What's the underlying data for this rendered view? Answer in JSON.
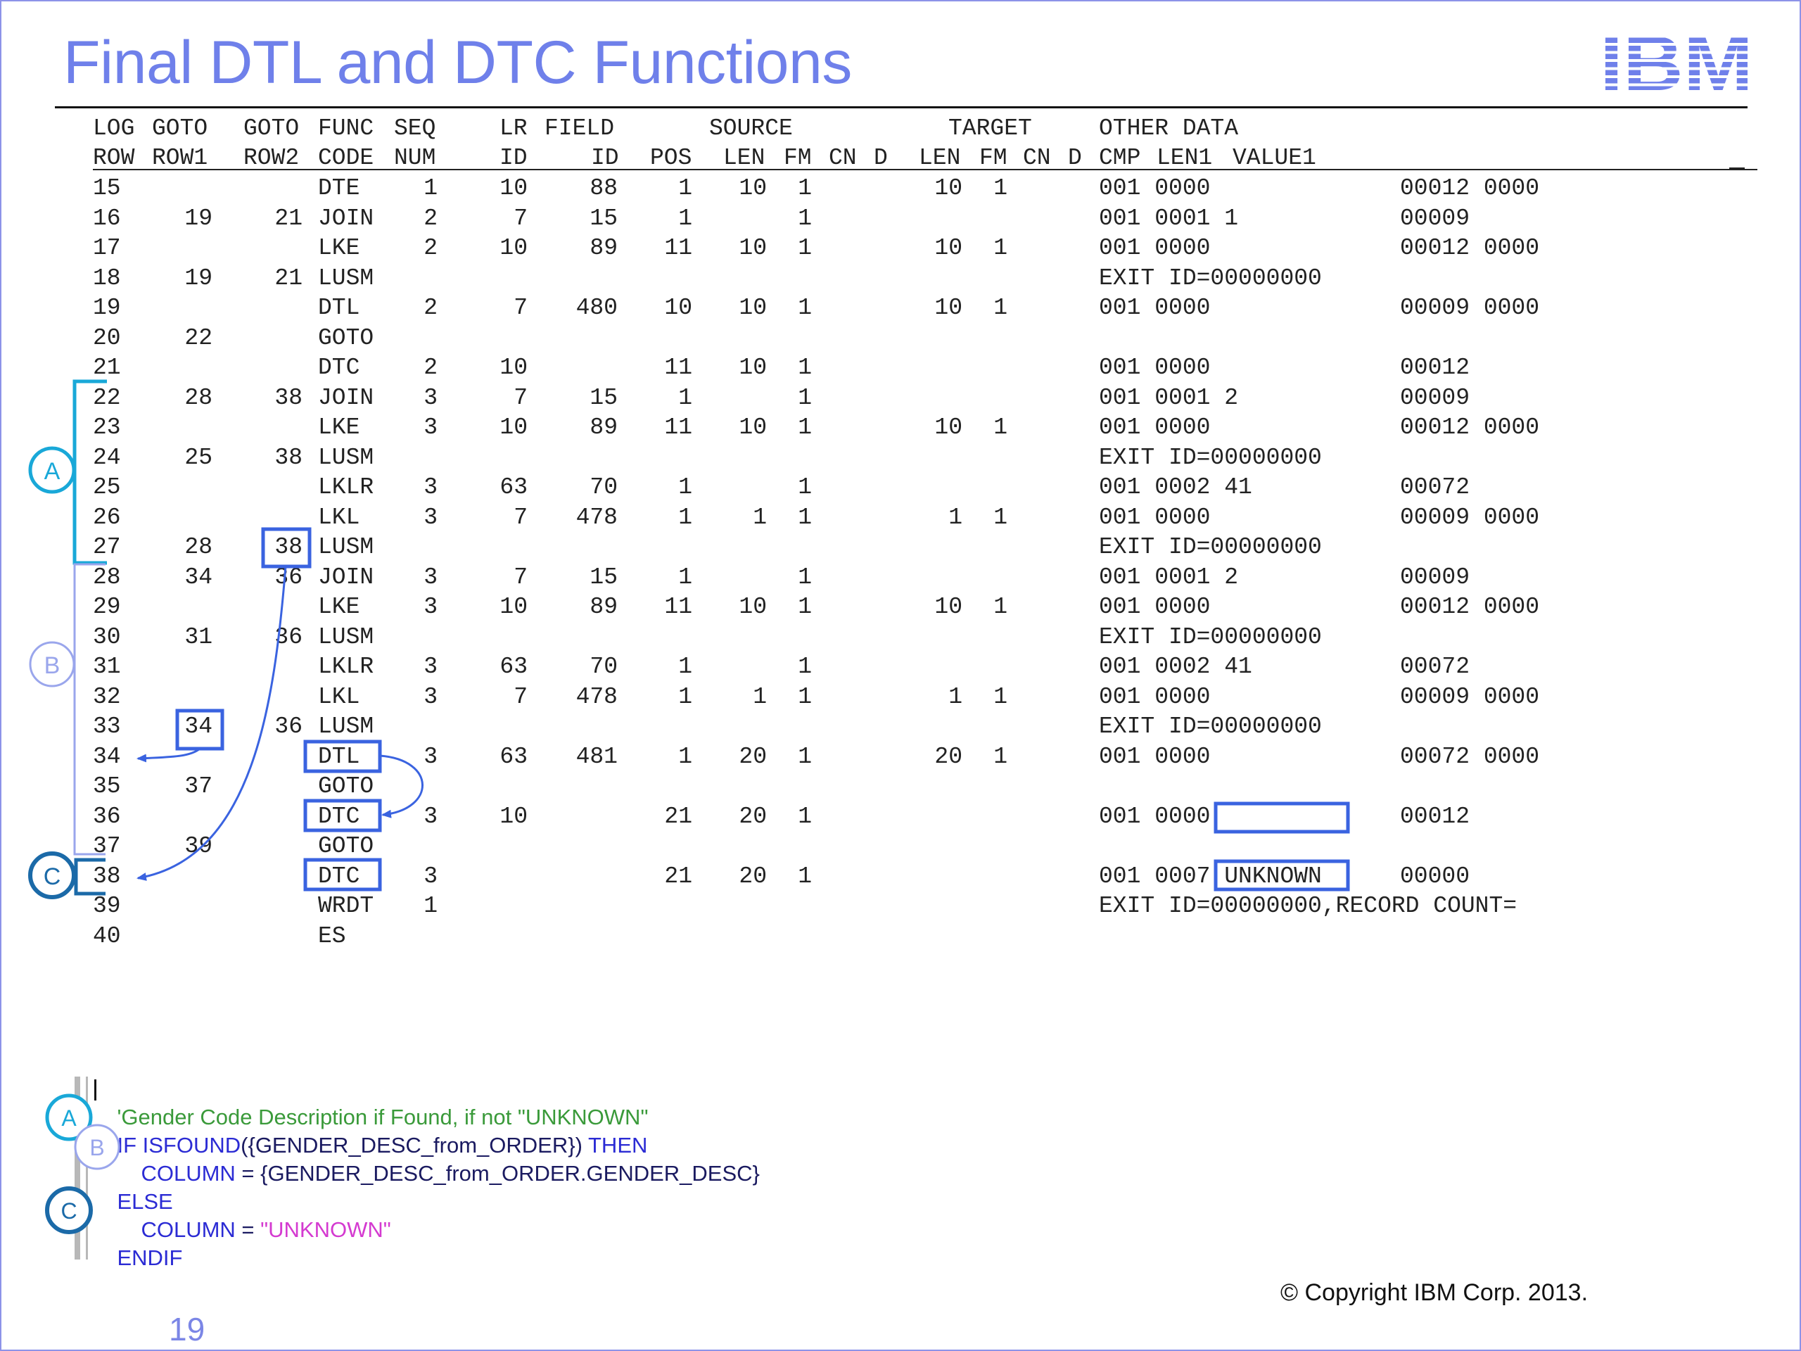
{
  "slide": {
    "title": "Final DTL and DTC Functions",
    "logo_text": "IBM",
    "copyright": "© Copyright IBM Corp. 2013.",
    "page_number": "19"
  },
  "headers": {
    "line1": [
      "LOG",
      "GOTO",
      "GOTO",
      "FUNC",
      "SEQ",
      "LR",
      "FIELD",
      "SOURCE",
      "TARGET",
      "OTHER DATA"
    ],
    "line2": [
      "ROW",
      "ROW1",
      "ROW2",
      "CODE",
      "NUM",
      "ID",
      "ID",
      "POS",
      "LEN",
      "FM",
      "CN",
      "D",
      "LEN",
      "FM",
      "CN",
      "D",
      "CMP",
      "LEN1",
      "VALUE1"
    ]
  },
  "rows": [
    {
      "row": "15",
      "goto1": "",
      "goto2": "",
      "func": "DTE",
      "seq": "1",
      "lr": "10",
      "field": "88",
      "pos": "1",
      "slen": "10",
      "sfm": "1",
      "tlen": "10",
      "tfm": "1",
      "cmp": "001 0000",
      "tail": "00012 0000"
    },
    {
      "row": "16",
      "goto1": "19",
      "goto2": "21",
      "func": "JOIN",
      "seq": "2",
      "lr": "7",
      "field": "15",
      "pos": "1",
      "slen": "",
      "sfm": "1",
      "tlen": "",
      "tfm": "",
      "cmp": "001 0001 1",
      "tail": "00009"
    },
    {
      "row": "17",
      "goto1": "",
      "goto2": "",
      "func": "LKE",
      "seq": "2",
      "lr": "10",
      "field": "89",
      "pos": "11",
      "slen": "10",
      "sfm": "1",
      "tlen": "10",
      "tfm": "1",
      "cmp": "001 0000",
      "tail": "00012 0000"
    },
    {
      "row": "18",
      "goto1": "19",
      "goto2": "21",
      "func": "LUSM",
      "seq": "",
      "lr": "",
      "field": "",
      "pos": "",
      "slen": "",
      "sfm": "",
      "tlen": "",
      "tfm": "",
      "cmp": "EXIT ID=00000000",
      "tail": ""
    },
    {
      "row": "19",
      "goto1": "",
      "goto2": "",
      "func": "DTL",
      "seq": "2",
      "lr": "7",
      "field": "480",
      "pos": "10",
      "slen": "10",
      "sfm": "1",
      "tlen": "10",
      "tfm": "1",
      "cmp": "001 0000",
      "tail": "00009 0000"
    },
    {
      "row": "20",
      "goto1": "22",
      "goto2": "",
      "func": "GOTO",
      "seq": "",
      "lr": "",
      "field": "",
      "pos": "",
      "slen": "",
      "sfm": "",
      "tlen": "",
      "tfm": "",
      "cmp": "",
      "tail": ""
    },
    {
      "row": "21",
      "goto1": "",
      "goto2": "",
      "func": "DTC",
      "seq": "2",
      "lr": "10",
      "field": "",
      "pos": "11",
      "slen": "10",
      "sfm": "1",
      "tlen": "",
      "tfm": "",
      "cmp": "001 0000",
      "tail": "00012"
    },
    {
      "row": "22",
      "goto1": "28",
      "goto2": "38",
      "func": "JOIN",
      "seq": "3",
      "lr": "7",
      "field": "15",
      "pos": "1",
      "slen": "",
      "sfm": "1",
      "tlen": "",
      "tfm": "",
      "cmp": "001 0001 2",
      "tail": "00009"
    },
    {
      "row": "23",
      "goto1": "",
      "goto2": "",
      "func": "LKE",
      "seq": "3",
      "lr": "10",
      "field": "89",
      "pos": "11",
      "slen": "10",
      "sfm": "1",
      "tlen": "10",
      "tfm": "1",
      "cmp": "001 0000",
      "tail": "00012 0000"
    },
    {
      "row": "24",
      "goto1": "25",
      "goto2": "38",
      "func": "LUSM",
      "seq": "",
      "lr": "",
      "field": "",
      "pos": "",
      "slen": "",
      "sfm": "",
      "tlen": "",
      "tfm": "",
      "cmp": "EXIT ID=00000000",
      "tail": ""
    },
    {
      "row": "25",
      "goto1": "",
      "goto2": "",
      "func": "LKLR",
      "seq": "3",
      "lr": "63",
      "field": "70",
      "pos": "1",
      "slen": "",
      "sfm": "1",
      "tlen": "",
      "tfm": "",
      "cmp": "001 0002 41",
      "tail": "00072"
    },
    {
      "row": "26",
      "goto1": "",
      "goto2": "",
      "func": "LKL",
      "seq": "3",
      "lr": "7",
      "field": "478",
      "pos": "1",
      "slen": "1",
      "sfm": "1",
      "tlen": "1",
      "tfm": "1",
      "cmp": "001 0000",
      "tail": "00009 0000"
    },
    {
      "row": "27",
      "goto1": "28",
      "goto2": "38",
      "func": "LUSM",
      "seq": "",
      "lr": "",
      "field": "",
      "pos": "",
      "slen": "",
      "sfm": "",
      "tlen": "",
      "tfm": "",
      "cmp": "EXIT ID=00000000",
      "tail": ""
    },
    {
      "row": "28",
      "goto1": "34",
      "goto2": "36",
      "func": "JOIN",
      "seq": "3",
      "lr": "7",
      "field": "15",
      "pos": "1",
      "slen": "",
      "sfm": "1",
      "tlen": "",
      "tfm": "",
      "cmp": "001 0001 2",
      "tail": "00009"
    },
    {
      "row": "29",
      "goto1": "",
      "goto2": "",
      "func": "LKE",
      "seq": "3",
      "lr": "10",
      "field": "89",
      "pos": "11",
      "slen": "10",
      "sfm": "1",
      "tlen": "10",
      "tfm": "1",
      "cmp": "001 0000",
      "tail": "00012 0000"
    },
    {
      "row": "30",
      "goto1": "31",
      "goto2": "36",
      "func": "LUSM",
      "seq": "",
      "lr": "",
      "field": "",
      "pos": "",
      "slen": "",
      "sfm": "",
      "tlen": "",
      "tfm": "",
      "cmp": "EXIT ID=00000000",
      "tail": ""
    },
    {
      "row": "31",
      "goto1": "",
      "goto2": "",
      "func": "LKLR",
      "seq": "3",
      "lr": "63",
      "field": "70",
      "pos": "1",
      "slen": "",
      "sfm": "1",
      "tlen": "",
      "tfm": "",
      "cmp": "001 0002 41",
      "tail": "00072"
    },
    {
      "row": "32",
      "goto1": "",
      "goto2": "",
      "func": "LKL",
      "seq": "3",
      "lr": "7",
      "field": "478",
      "pos": "1",
      "slen": "1",
      "sfm": "1",
      "tlen": "1",
      "tfm": "1",
      "cmp": "001 0000",
      "tail": "00009 0000"
    },
    {
      "row": "33",
      "goto1": "34",
      "goto2": "36",
      "func": "LUSM",
      "seq": "",
      "lr": "",
      "field": "",
      "pos": "",
      "slen": "",
      "sfm": "",
      "tlen": "",
      "tfm": "",
      "cmp": "EXIT ID=00000000",
      "tail": ""
    },
    {
      "row": "34",
      "goto1": "",
      "goto2": "",
      "func": "DTL",
      "seq": "3",
      "lr": "63",
      "field": "481",
      "pos": "1",
      "slen": "20",
      "sfm": "1",
      "tlen": "20",
      "tfm": "1",
      "cmp": "001 0000",
      "tail": "00072 0000"
    },
    {
      "row": "35",
      "goto1": "37",
      "goto2": "",
      "func": "GOTO",
      "seq": "",
      "lr": "",
      "field": "",
      "pos": "",
      "slen": "",
      "sfm": "",
      "tlen": "",
      "tfm": "",
      "cmp": "",
      "tail": ""
    },
    {
      "row": "36",
      "goto1": "",
      "goto2": "",
      "func": "DTC",
      "seq": "3",
      "lr": "10",
      "field": "",
      "pos": "21",
      "slen": "20",
      "sfm": "1",
      "tlen": "",
      "tfm": "",
      "cmp": "001 0000",
      "tail": "00012"
    },
    {
      "row": "37",
      "goto1": "39",
      "goto2": "",
      "func": "GOTO",
      "seq": "",
      "lr": "",
      "field": "",
      "pos": "",
      "slen": "",
      "sfm": "",
      "tlen": "",
      "tfm": "",
      "cmp": "",
      "tail": ""
    },
    {
      "row": "38",
      "goto1": "",
      "goto2": "",
      "func": "DTC",
      "seq": "3",
      "lr": "",
      "field": "",
      "pos": "21",
      "slen": "20",
      "sfm": "1",
      "tlen": "",
      "tfm": "",
      "cmp": "001 0007 UNKNOWN",
      "tail": "00000"
    },
    {
      "row": "39",
      "goto1": "",
      "goto2": "",
      "func": "WRDT",
      "seq": "1",
      "lr": "",
      "field": "",
      "pos": "",
      "slen": "",
      "sfm": "",
      "tlen": "",
      "tfm": "",
      "cmp": "EXIT ID=00000000,RECORD COUNT=",
      "tail": ""
    },
    {
      "row": "40",
      "goto1": "",
      "goto2": "",
      "func": "ES",
      "seq": "",
      "lr": "",
      "field": "",
      "pos": "",
      "slen": "",
      "sfm": "",
      "tlen": "",
      "tfm": "",
      "cmp": "",
      "tail": ""
    }
  ],
  "markers": {
    "a": "A",
    "b": "B",
    "c": "C"
  },
  "code": {
    "comment": "'Gender Code Description if Found, if not \"UNKNOWN\"",
    "if_kw": "IF",
    "if_fn": "ISFOUND",
    "if_arg": "({GENDER_DESC_from_ORDER})",
    "then_kw": "THEN",
    "col_kw": "COLUMN",
    "col_expr": "= {GENDER_DESC_from_ORDER.GENDER_DESC}",
    "else_kw": "ELSE",
    "col2_kw": "COLUMN",
    "col2_eq": "=",
    "col2_str": "\"UNKNOWN\"",
    "endif_kw": "ENDIF"
  },
  "colors": {
    "title": "#6f80ea",
    "highlight_box": "#3a63e0",
    "bracket_a": "#19a8d8",
    "bracket_b": "#9aa6ec",
    "bracket_c": "#1b6aa8",
    "arrow": "#3a63e0",
    "code_keyword": "#2b2bd4",
    "code_comment": "#3a9a3a",
    "code_string": "#d43ad0"
  },
  "icons": {
    "logo": "ibm-striped-logo"
  }
}
